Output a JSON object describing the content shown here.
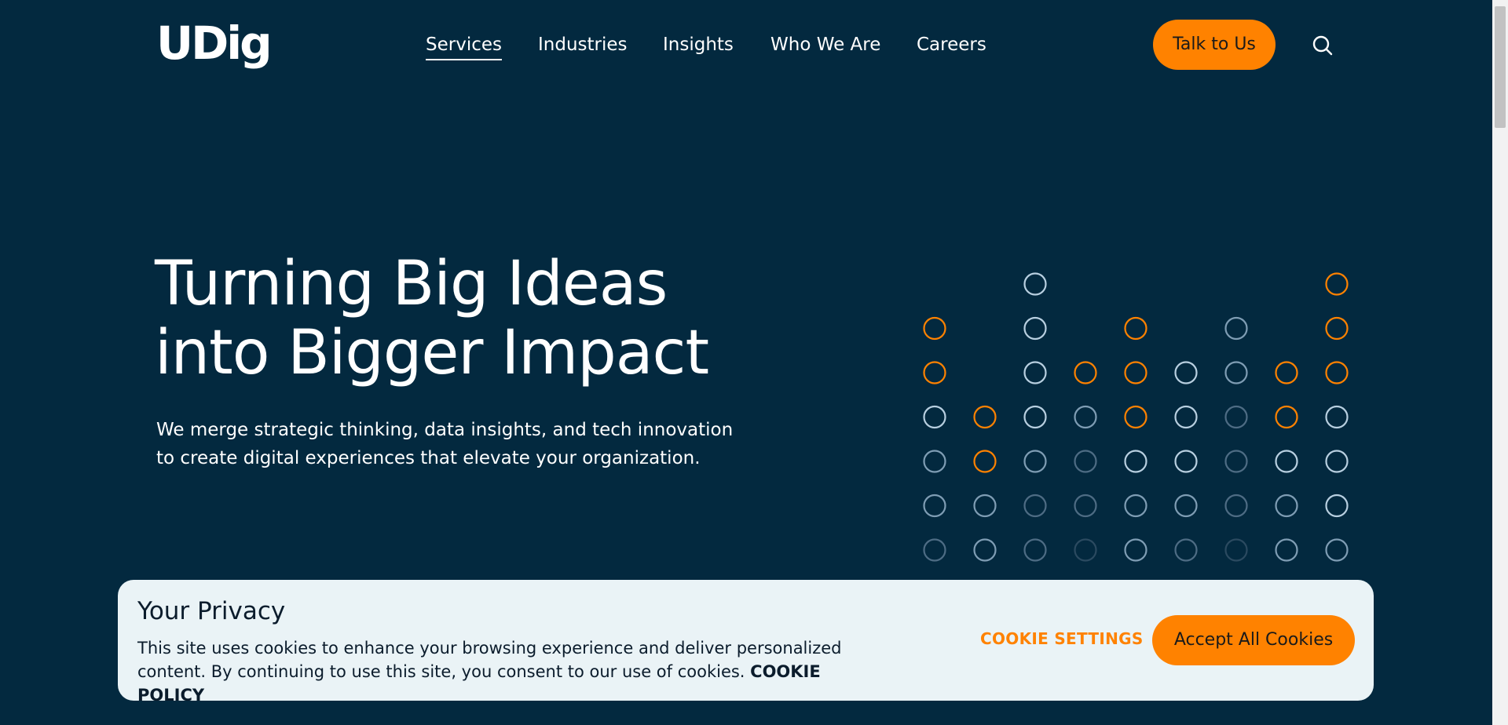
{
  "header": {
    "logo_text": "UDig",
    "nav": [
      {
        "label": "Services",
        "active": true
      },
      {
        "label": "Industries",
        "active": false
      },
      {
        "label": "Insights",
        "active": false
      },
      {
        "label": "Who We Are",
        "active": false
      },
      {
        "label": "Careers",
        "active": false
      }
    ],
    "cta_label": "Talk to Us",
    "search_icon": "search-icon"
  },
  "hero": {
    "title_line1": "Turning Big Ideas",
    "title_line2": "into Bigger Impact",
    "subtitle_line1": "We merge strategic thinking, data insights, and tech innovation",
    "subtitle_line2": "to create digital experiences that elevate your organization."
  },
  "dot_grid": {
    "colors": {
      "orange": "#ff8200",
      "light": "#b8cfe0",
      "mid": "#7f9db4",
      "dim": "#4e6c84",
      "faint": "#2b4a60"
    },
    "rows": [
      [
        "",
        "",
        "light",
        "",
        "",
        "",
        "",
        "",
        "orange"
      ],
      [
        "orange",
        "",
        "light",
        "",
        "orange",
        "",
        "mid",
        "",
        "orange"
      ],
      [
        "orange",
        "",
        "light",
        "orange",
        "orange",
        "light",
        "mid",
        "orange",
        "orange"
      ],
      [
        "light",
        "orange",
        "light",
        "mid",
        "orange",
        "light",
        "dim",
        "orange",
        "light"
      ],
      [
        "mid",
        "orange",
        "mid",
        "dim",
        "light",
        "light",
        "dim",
        "light",
        "light"
      ],
      [
        "mid",
        "mid",
        "dim",
        "dim",
        "mid",
        "mid",
        "dim",
        "mid",
        "light"
      ],
      [
        "dim",
        "mid",
        "dim",
        "faint",
        "mid",
        "dim",
        "faint",
        "mid",
        "mid"
      ]
    ]
  },
  "cookie_banner": {
    "title": "Your Privacy",
    "text_line1": "This site uses cookies to enhance your browsing experience and deliver personalized",
    "text_line2": "content. By continuing to use this site, you consent to our use of cookies.",
    "policy_link": "COOKIE POLICY",
    "settings_label": "COOKIE SETTINGS",
    "accept_label": "Accept All Cookies"
  },
  "theme": {
    "background": "#03293f",
    "accent": "#ff8200",
    "banner_bg": "#eaf3f6"
  }
}
